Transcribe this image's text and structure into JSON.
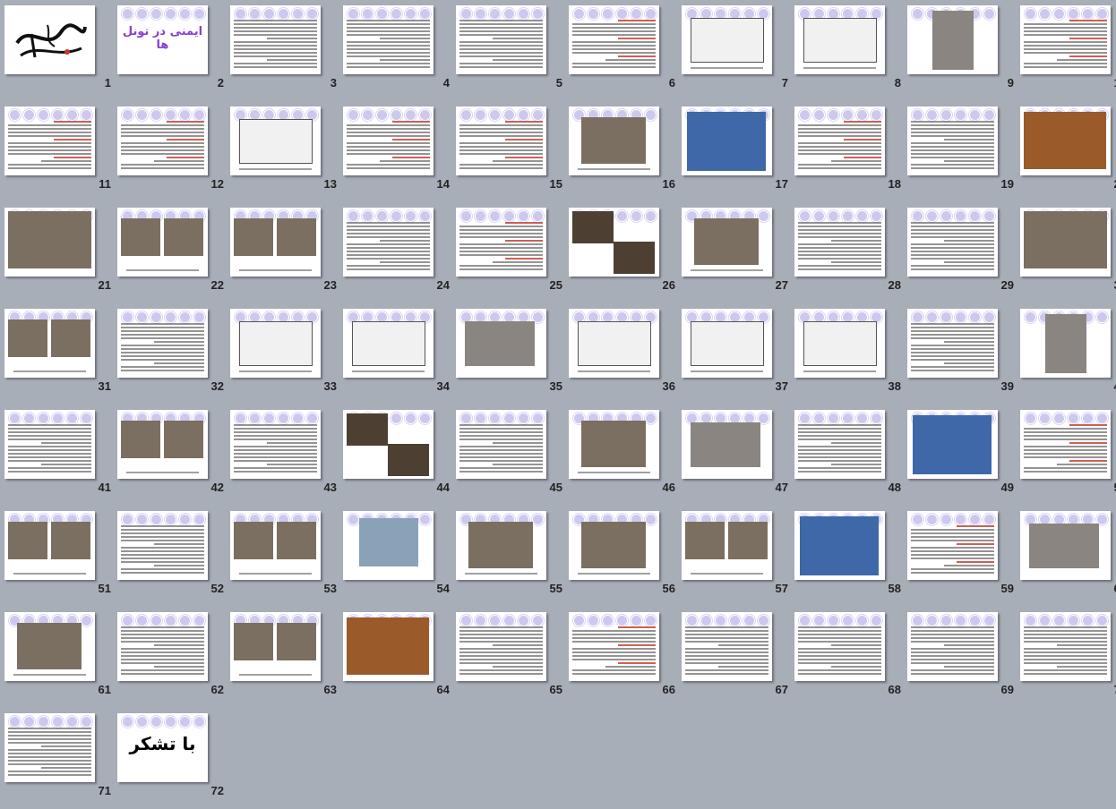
{
  "app": {
    "view": "slide-sorter",
    "total_slides": 72
  },
  "colors": {
    "background": "#a8aeb8",
    "slide_bg": "#ffffff",
    "accent_circles": "#cdc9ee",
    "title_purple": "#8a3fd1",
    "heading_red": "#c0392b"
  },
  "slides": [
    {
      "number": "1",
      "kind": "calligraphy",
      "logo_text": "بسم الله الرحمن الرحیم"
    },
    {
      "number": "2",
      "kind": "title",
      "title": "ایمنی در تونل ها"
    },
    {
      "number": "3",
      "kind": "text"
    },
    {
      "number": "4",
      "kind": "text"
    },
    {
      "number": "5",
      "kind": "text"
    },
    {
      "number": "6",
      "kind": "text-red"
    },
    {
      "number": "7",
      "kind": "drawing"
    },
    {
      "number": "8",
      "kind": "drawing"
    },
    {
      "number": "9",
      "kind": "photo-small"
    },
    {
      "number": "10",
      "kind": "text-red"
    },
    {
      "number": "11",
      "kind": "text-red"
    },
    {
      "number": "12",
      "kind": "text-red"
    },
    {
      "number": "13",
      "kind": "drawing"
    },
    {
      "number": "14",
      "kind": "text-red"
    },
    {
      "number": "15",
      "kind": "text-red"
    },
    {
      "number": "16",
      "kind": "photo"
    },
    {
      "number": "17",
      "kind": "photo-blue"
    },
    {
      "number": "18",
      "kind": "text-red"
    },
    {
      "number": "19",
      "kind": "text"
    },
    {
      "number": "20",
      "kind": "photo-rust"
    },
    {
      "number": "21",
      "kind": "photo-full"
    },
    {
      "number": "22",
      "kind": "photo-two"
    },
    {
      "number": "23",
      "kind": "photo-two"
    },
    {
      "number": "24",
      "kind": "text"
    },
    {
      "number": "25",
      "kind": "text-red"
    },
    {
      "number": "26",
      "kind": "photo-dark"
    },
    {
      "number": "27",
      "kind": "photo"
    },
    {
      "number": "28",
      "kind": "text"
    },
    {
      "number": "29",
      "kind": "text"
    },
    {
      "number": "30",
      "kind": "photo-full"
    },
    {
      "number": "31",
      "kind": "photo-two"
    },
    {
      "number": "32",
      "kind": "text"
    },
    {
      "number": "33",
      "kind": "drawing"
    },
    {
      "number": "34",
      "kind": "drawing"
    },
    {
      "number": "35",
      "kind": "photo-gray"
    },
    {
      "number": "36",
      "kind": "drawing"
    },
    {
      "number": "37",
      "kind": "drawing"
    },
    {
      "number": "38",
      "kind": "drawing"
    },
    {
      "number": "39",
      "kind": "text"
    },
    {
      "number": "40",
      "kind": "photo-small"
    },
    {
      "number": "41",
      "kind": "text"
    },
    {
      "number": "42",
      "kind": "photo-two"
    },
    {
      "number": "43",
      "kind": "text"
    },
    {
      "number": "44",
      "kind": "photo-dark"
    },
    {
      "number": "45",
      "kind": "text"
    },
    {
      "number": "46",
      "kind": "photo"
    },
    {
      "number": "47",
      "kind": "photo-gray"
    },
    {
      "number": "48",
      "kind": "text"
    },
    {
      "number": "49",
      "kind": "photo-blue"
    },
    {
      "number": "50",
      "kind": "text-red"
    },
    {
      "number": "51",
      "kind": "photo-two"
    },
    {
      "number": "52",
      "kind": "text"
    },
    {
      "number": "53",
      "kind": "photo-two"
    },
    {
      "number": "54",
      "kind": "photo-sky"
    },
    {
      "number": "55",
      "kind": "photo"
    },
    {
      "number": "56",
      "kind": "photo"
    },
    {
      "number": "57",
      "kind": "photo-two"
    },
    {
      "number": "58",
      "kind": "photo-blue"
    },
    {
      "number": "59",
      "kind": "text-red"
    },
    {
      "number": "60",
      "kind": "photo-gray"
    },
    {
      "number": "61",
      "kind": "photo"
    },
    {
      "number": "62",
      "kind": "text"
    },
    {
      "number": "63",
      "kind": "photo-two"
    },
    {
      "number": "64",
      "kind": "photo-rust"
    },
    {
      "number": "65",
      "kind": "text"
    },
    {
      "number": "66",
      "kind": "text-red"
    },
    {
      "number": "67",
      "kind": "text"
    },
    {
      "number": "68",
      "kind": "text"
    },
    {
      "number": "69",
      "kind": "text"
    },
    {
      "number": "70",
      "kind": "text"
    },
    {
      "number": "71",
      "kind": "text"
    },
    {
      "number": "72",
      "kind": "thanks",
      "title": "با تشکر"
    }
  ]
}
